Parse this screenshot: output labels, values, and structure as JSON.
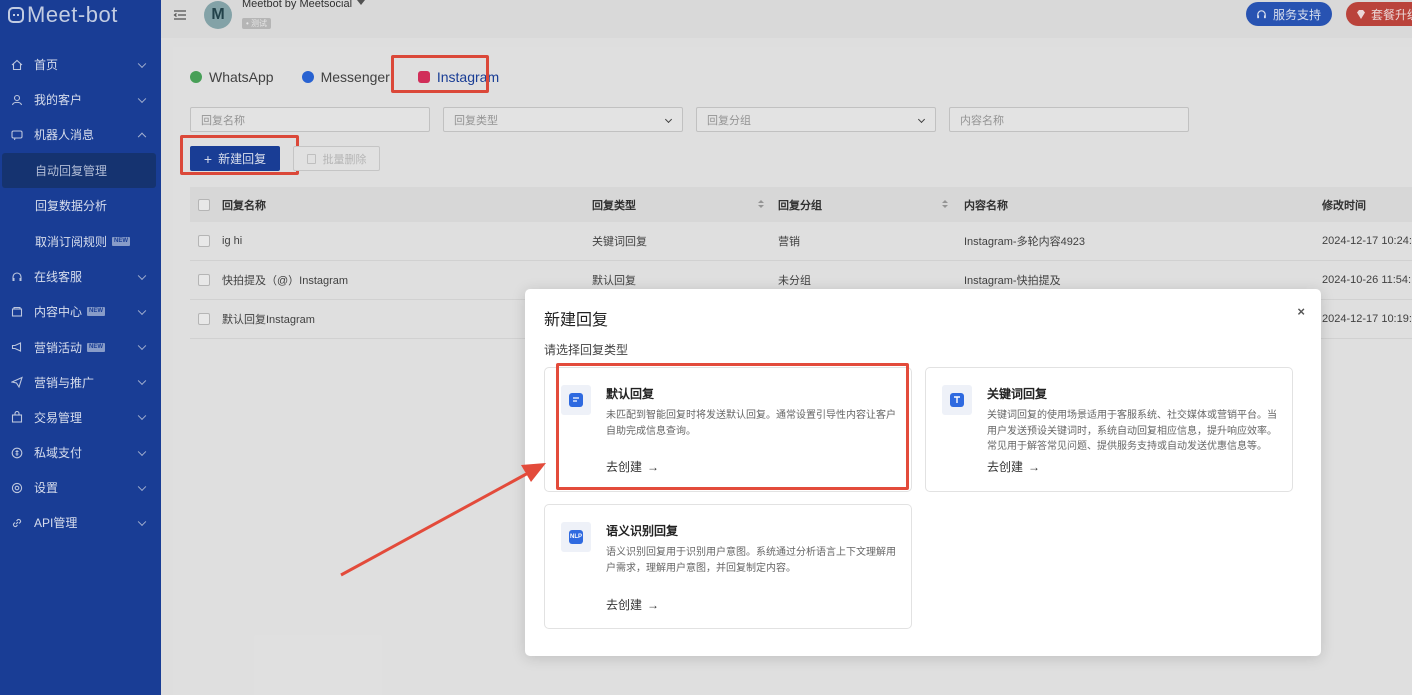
{
  "app": {
    "logo": "Meet-bot"
  },
  "sidebar": {
    "items": [
      {
        "label": "首页",
        "icon": "home-icon",
        "new": false
      },
      {
        "label": "我的客户",
        "icon": "user-icon",
        "new": false
      },
      {
        "label": "机器人消息",
        "icon": "bot-icon",
        "new": false,
        "expanded": true
      }
    ],
    "subitems": [
      {
        "label": "自动回复管理",
        "active": true
      },
      {
        "label": "回复数据分析",
        "active": false
      },
      {
        "label": "取消订阅规则",
        "active": false,
        "new_badge": "NEW"
      }
    ],
    "items2": [
      {
        "label": "在线客服",
        "icon": "headset-icon"
      },
      {
        "label": "内容中心",
        "icon": "content-icon",
        "new_badge": "NEW"
      },
      {
        "label": "营销活动",
        "icon": "megaphone-icon",
        "new_badge": "NEW"
      },
      {
        "label": "营销与推广",
        "icon": "send-icon"
      },
      {
        "label": "交易管理",
        "icon": "bag-icon"
      },
      {
        "label": "私域支付",
        "icon": "coin-icon"
      },
      {
        "label": "设置",
        "icon": "gear-icon"
      },
      {
        "label": "API管理",
        "icon": "link-icon"
      }
    ]
  },
  "header": {
    "avatar_letter": "M",
    "account_name": "Meetbot by Meetsocial",
    "env_tag": "• 测试",
    "support_label": "服务支持",
    "upgrade_label": "套餐升级"
  },
  "tabs": [
    {
      "label": "WhatsApp",
      "active": false
    },
    {
      "label": "Messenger",
      "active": false
    },
    {
      "label": "Instagram",
      "active": true
    }
  ],
  "filters": {
    "reply_name_placeholder": "回复名称",
    "reply_type_placeholder": "回复类型",
    "reply_group_placeholder": "回复分组",
    "content_name_placeholder": "内容名称"
  },
  "toolbar": {
    "new_label": "新建回复",
    "batch_delete_label": "批量删除"
  },
  "table": {
    "columns": [
      "回复名称",
      "回复类型",
      "回复分组",
      "内容名称",
      "修改时间"
    ],
    "rows": [
      {
        "name": "ig hi",
        "type": "关键词回复",
        "group": "营销",
        "content": "Instagram-多轮内容4923",
        "time": "2024-12-17 10:24:"
      },
      {
        "name": "快拍提及（@）Instagram",
        "type": "默认回复",
        "group": "未分组",
        "content": "Instagram-快拍提及",
        "time": "2024-10-26 11:54:"
      },
      {
        "name": "默认回复Instagram",
        "type": "",
        "group": "",
        "content": "",
        "time": "2024-12-17 10:19:"
      }
    ]
  },
  "modal": {
    "title": "新建回复",
    "close": "×",
    "subtitle": "请选择回复类型",
    "cards": [
      {
        "title": "默认回复",
        "desc": "未匹配到智能回复时将发送默认回复。通常设置引导性内容让客户自助完成信息查询。",
        "link": "去创建",
        "icon_text": ""
      },
      {
        "title": "关键词回复",
        "desc": "关键词回复的使用场景适用于客服系统、社交媒体或营销平台。当用户发送预设关键词时，系统自动回复相应信息，提升响应效率。常见用于解答常见问题、提供服务支持或自动发送优惠信息等。",
        "link": "去创建",
        "icon_text": ""
      },
      {
        "title": "语义识别回复",
        "desc": "语义识别回复用于识别用户意图。系统通过分析语言上下文理解用户需求，理解用户意图，并回复制定内容。",
        "link": "去创建",
        "icon_text": "NLP"
      }
    ],
    "arrow_glyph": "→"
  },
  "colors": {
    "sidebar": "#1a3f9a",
    "primary": "#1a3f9a",
    "highlight": "#e34b3b",
    "support": "#2a56b8",
    "upgrade": "#c0463d"
  }
}
